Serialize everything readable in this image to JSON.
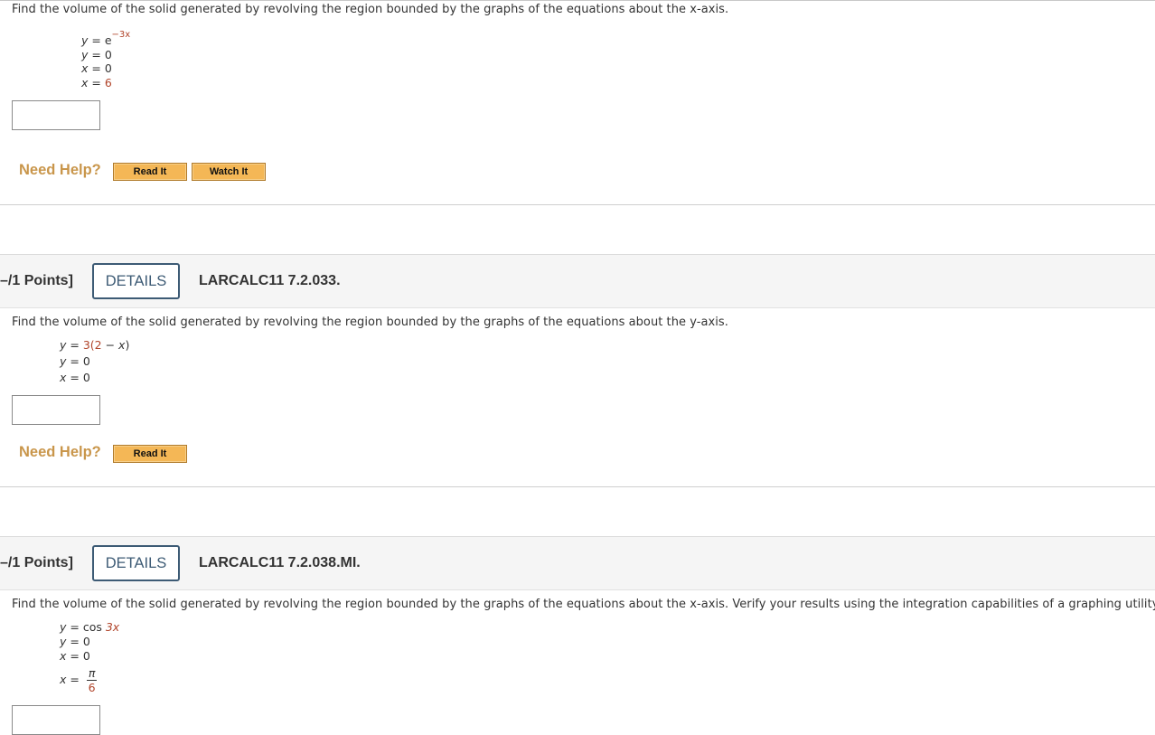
{
  "questions": [
    {
      "prompt": "Find the volume of the solid generated by revolving the region bounded by the graphs of the equations about the x-axis.",
      "equations": {
        "eq1": {
          "lhs": "y",
          "op": " = ",
          "base": "e",
          "exp": "−3x"
        },
        "eq2": {
          "lhs": "y",
          "op": " = ",
          "rhs": "0"
        },
        "eq3": {
          "lhs": "x",
          "op": " = ",
          "rhs": "0"
        },
        "eq4": {
          "lhs": "x",
          "op": " = ",
          "rhs": "6"
        }
      },
      "answer_value": "",
      "need_help_label": "Need Help?",
      "read_it_label": "Read It",
      "watch_it_label": "Watch It"
    },
    {
      "points_label": "–/1 Points]",
      "details_label": "DETAILS",
      "problem_id": "LARCALC11 7.2.033.",
      "prompt": "Find the volume of the solid generated by revolving the region bounded by the graphs of the equations about the y-axis.",
      "equations": {
        "eq1": {
          "lhs": "y",
          "op": " = ",
          "rhs_a": "3(2",
          "rhs_b": " − ",
          "rhs_c": "x",
          "rhs_d": ")"
        },
        "eq2": {
          "lhs": "y",
          "op": " = ",
          "rhs": "0"
        },
        "eq3": {
          "lhs": "x",
          "op": " = ",
          "rhs": "0"
        }
      },
      "answer_value": "",
      "need_help_label": "Need Help?",
      "read_it_label": "Read It"
    },
    {
      "points_label": "–/1 Points]",
      "details_label": "DETAILS",
      "problem_id": "LARCALC11 7.2.038.MI.",
      "prompt": "Find the volume of the solid generated by revolving the region bounded by the graphs of the equations about the x-axis. Verify your results using the integration capabilities of a graphing utility.",
      "equations": {
        "eq1": {
          "lhs": "y",
          "op": " = ",
          "fn": "cos ",
          "arg": "3x"
        },
        "eq2": {
          "lhs": "y",
          "op": " = ",
          "rhs": "0"
        },
        "eq3": {
          "lhs": "x",
          "op": " = ",
          "rhs": "0"
        },
        "eq4": {
          "lhs": "x",
          "op": " = ",
          "num": "π",
          "den": "6"
        }
      }
    }
  ]
}
